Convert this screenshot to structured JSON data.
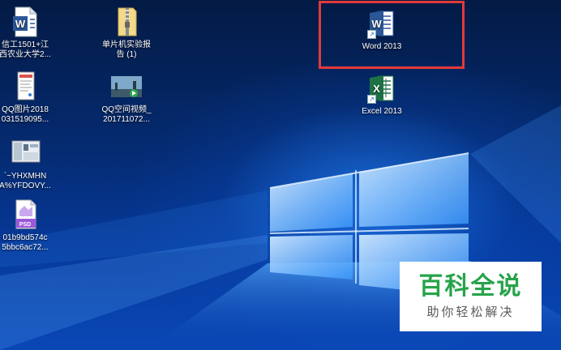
{
  "desktop": {
    "icons": [
      {
        "label": "信工1501+江\n西农业大学2...",
        "icon": "word-document-icon"
      },
      {
        "label": "单片机实验报\n告 (1)",
        "icon": "zip-folder-icon"
      },
      {
        "label": "Word 2013",
        "icon": "word-app-icon"
      },
      {
        "label": "QQ图片2018\n031519095...",
        "icon": "image-file-icon"
      },
      {
        "label": "QQ空间视频_\n201711072...",
        "icon": "video-file-icon"
      },
      {
        "label": "Excel 2013",
        "icon": "excel-app-icon"
      },
      {
        "label": "`~YHXMHN\nA%YFDOVY...",
        "icon": "image-file-icon"
      },
      {
        "label": "01b9bd574c\n5bbc6ac72...",
        "icon": "psd-file-icon"
      }
    ]
  },
  "psd_badge": "PSD",
  "watermark": {
    "title": "百科全说",
    "subtitle": "助你轻松解决"
  },
  "colors": {
    "highlight_border": "#e23a3a",
    "word_blue": "#2b5797",
    "excel_green": "#1e7145",
    "watermark_green": "#27a34a"
  }
}
